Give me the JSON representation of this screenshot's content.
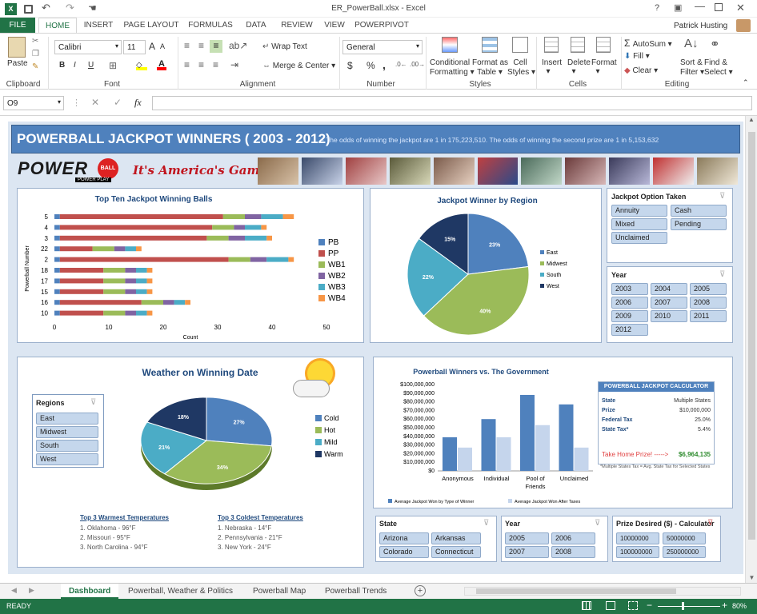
{
  "window": {
    "title": "ER_PowerBall.xlsx - Excel",
    "user": "Patrick Husting"
  },
  "colors": {
    "excel_green": "#217346",
    "dashboard_bg": "#dce6f2",
    "header_blue": "#4f81bd",
    "pb": "#4f81bd",
    "pp": "#c0504d",
    "wb1": "#9bbb59",
    "wb2": "#8064a2",
    "wb3": "#4bacc6",
    "wb4": "#f79646",
    "east": "#4f81bd",
    "midwest": "#9bbb59",
    "south": "#4bacc6",
    "west": "#1f3864"
  },
  "ribbon": {
    "tabs": [
      "FILE",
      "HOME",
      "INSERT",
      "PAGE LAYOUT",
      "FORMULAS",
      "DATA",
      "REVIEW",
      "VIEW",
      "POWERPIVOT"
    ],
    "active_tab": "HOME",
    "clipboard": {
      "paste": "Paste",
      "label": "Clipboard"
    },
    "font": {
      "name": "Calibri",
      "size": "11",
      "bold": "B",
      "italic": "I",
      "underline": "U",
      "grow": "A",
      "shrink": "A",
      "label": "Font"
    },
    "alignment": {
      "wrap": "Wrap Text",
      "merge": "Merge & Center",
      "label": "Alignment"
    },
    "number": {
      "format": "General",
      "currency": "$",
      "percent": "%",
      "comma": ",",
      "label": "Number"
    },
    "styles": {
      "conditional": "Conditional",
      "conditional2": "Formatting",
      "format_as": "Format as",
      "format_as2": "Table",
      "cell": "Cell",
      "cell2": "Styles",
      "label": "Styles"
    },
    "cells": {
      "insert": "Insert",
      "delete": "Delete",
      "format": "Format",
      "label": "Cells"
    },
    "editing": {
      "autosum": "AutoSum",
      "fill": "Fill",
      "clear": "Clear",
      "sort": "Sort &",
      "sort2": "Filter",
      "find": "Find &",
      "find2": "Select",
      "label": "Editing"
    }
  },
  "formula_bar": {
    "name_box": "O9",
    "fx": "fx",
    "value": ""
  },
  "dashboard": {
    "title": "POWERBALL JACKPOT WINNERS ( 2003 - 2012)",
    "subtitle": "- The odds of winning the jackpot are 1 in 175,223,510. The odds of winning the second prize are 1 in 5,153,632",
    "logo_text": "POWER",
    "logo_ball": "BALL",
    "logo_play": "POWER PLAY",
    "slogan": "It's America's Game"
  },
  "chart_data": [
    {
      "type": "bar",
      "orientation": "horizontal",
      "stacked": true,
      "title": "Top Ten Jackpot Winning Balls",
      "xlabel": "Count",
      "ylabel": "Powerball Number",
      "categories": [
        "5",
        "4",
        "3",
        "22",
        "2",
        "18",
        "17",
        "15",
        "16",
        "10"
      ],
      "xlim": [
        0,
        50
      ],
      "xticks": [
        "0",
        "10",
        "20",
        "30",
        "40",
        "50"
      ],
      "series": [
        {
          "name": "PB",
          "values": [
            1,
            1,
            1,
            1,
            1,
            1,
            1,
            1,
            1,
            1
          ]
        },
        {
          "name": "PP",
          "values": [
            30,
            28,
            27,
            6,
            31,
            8,
            8,
            8,
            15,
            8
          ]
        },
        {
          "name": "WB1",
          "values": [
            4,
            4,
            4,
            4,
            4,
            4,
            4,
            4,
            4,
            4
          ]
        },
        {
          "name": "WB2",
          "values": [
            3,
            2,
            3,
            2,
            3,
            2,
            2,
            2,
            2,
            2
          ]
        },
        {
          "name": "WB3",
          "values": [
            4,
            3,
            4,
            2,
            4,
            2,
            2,
            2,
            2,
            2
          ]
        },
        {
          "name": "WB4",
          "values": [
            2,
            1,
            1,
            1,
            1,
            1,
            1,
            1,
            1,
            1
          ]
        }
      ],
      "legend": "right"
    },
    {
      "type": "pie",
      "title": "Jackpot Winner by Region",
      "categories": [
        "East",
        "Midwest",
        "South",
        "West"
      ],
      "values": [
        23,
        40,
        22,
        15
      ],
      "labels": [
        "23%",
        "40%",
        "22%",
        "15%"
      ],
      "legend": "right"
    },
    {
      "type": "pie",
      "title": "Weather on Winning Date",
      "categories": [
        "Cold",
        "Hot",
        "Mild",
        "Warm"
      ],
      "values": [
        27,
        34,
        21,
        18
      ],
      "labels": [
        "27%",
        "34%",
        "21%",
        "18%"
      ],
      "legend": "right"
    },
    {
      "type": "bar",
      "title": "Powerball Winners vs. The Government",
      "categories": [
        "Anonymous",
        "Individual",
        "Pool of Friends",
        "Unclaimed"
      ],
      "ylim": [
        0,
        100000000
      ],
      "yticks": [
        "$0",
        "$10,000,000",
        "$20,000,000",
        "$30,000,000",
        "$40,000,000",
        "$50,000,000",
        "$60,000,000",
        "$70,000,000",
        "$80,000,000",
        "$90,000,000",
        "$100,000,000"
      ],
      "series": [
        {
          "name": "Average Jackpot Won by Type of Winner",
          "values": [
            39000000,
            60000000,
            88000000,
            77000000
          ]
        },
        {
          "name": "Average Jackpot Won After Taxes",
          "values": [
            27000000,
            39000000,
            53000000,
            27000000
          ]
        }
      ],
      "legend": "bottom"
    }
  ],
  "slicers": {
    "option": {
      "title": "Jackpot Option Taken",
      "items": [
        "Annuity",
        "Cash",
        "Mixed",
        "Pending",
        "Unclaimed"
      ]
    },
    "year_top": {
      "title": "Year",
      "items": [
        "2003",
        "2004",
        "2005",
        "2006",
        "2007",
        "2008",
        "2009",
        "2010",
        "2011",
        "2012"
      ]
    },
    "regions": {
      "title": "Regions",
      "items": [
        "East",
        "Midwest",
        "South",
        "West"
      ]
    },
    "state": {
      "title": "State",
      "items": [
        "Arizona",
        "Arkansas",
        "Colorado",
        "Connecticut"
      ]
    },
    "year_bottom": {
      "title": "Year",
      "items": [
        "2005",
        "2006",
        "2007",
        "2008"
      ]
    },
    "prize": {
      "title": "Prize Desired ($) - Calculator",
      "items": [
        "10000000",
        "50000000",
        "100000000",
        "250000000"
      ]
    }
  },
  "temperatures": {
    "warm_title": "Top 3 Warmest Temperatures",
    "warm": [
      "1. Oklahoma - 96°F",
      "2. Missouri - 95°F",
      "3. North Carolina - 94°F"
    ],
    "cold_title": "Top 3 Coldest Temperatures",
    "cold": [
      "1. Nebraska - 14°F",
      "2. Pennsylvania - 21°F",
      "3. New York - 24°F"
    ]
  },
  "calculator": {
    "title": "POWERBALL JACKPOT CALCULATOR",
    "rows": [
      {
        "label": "State",
        "value": "Multiple States"
      },
      {
        "label": "Prize",
        "value": "$10,000,000"
      },
      {
        "label": "Federal Tax",
        "value": "25.0%"
      },
      {
        "label": "State Tax*",
        "value": "5.4%"
      }
    ],
    "take_home_label": "Take Home Prize! ----->",
    "take_home_value": "$6,964,135",
    "footnote": "*Multiple States Tax = Avg. State Tax for Selected States"
  },
  "sheet_tabs": [
    "Dashboard",
    "Powerball, Weather & Politics",
    "Powerball Map",
    "Powerball Trends"
  ],
  "active_sheet": "Dashboard",
  "status": {
    "ready": "READY",
    "zoom": "80%"
  }
}
